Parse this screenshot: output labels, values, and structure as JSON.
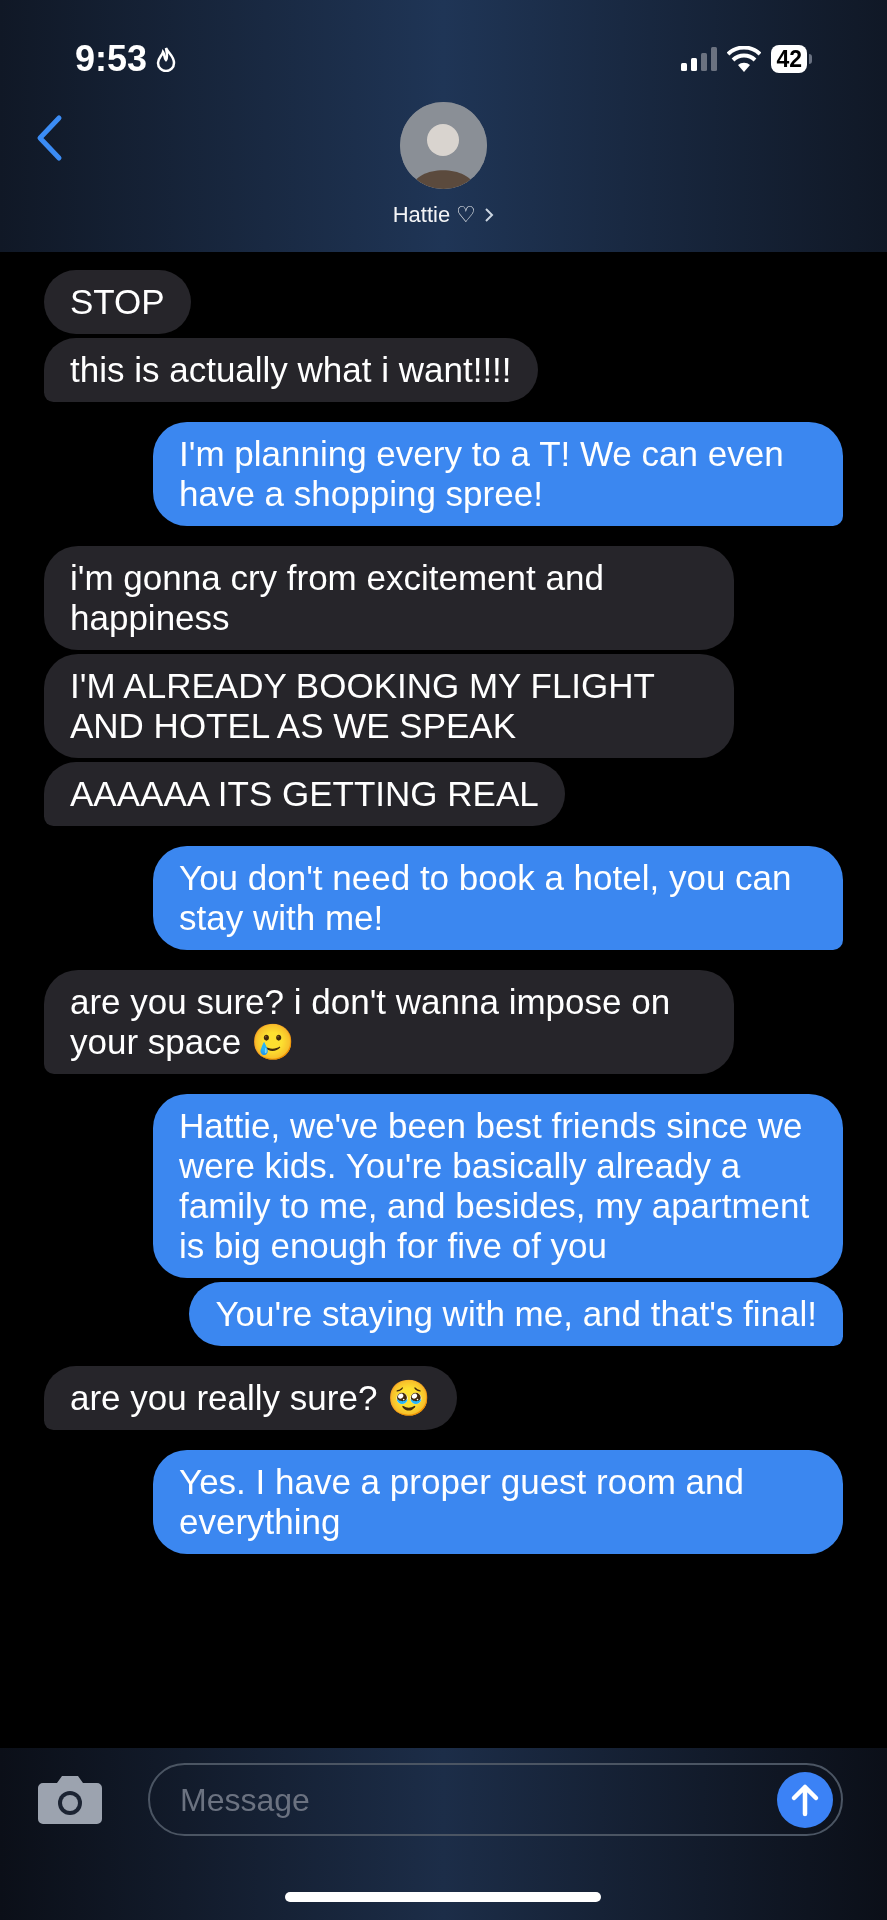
{
  "status_bar": {
    "time": "9:53",
    "battery": "42"
  },
  "contact": {
    "name": "Hattie ♡"
  },
  "messages": [
    {
      "kind": "received",
      "text": "STOP",
      "tail": false
    },
    {
      "kind": "received",
      "text": "this is actually what i want!!!!",
      "tail": true
    },
    {
      "kind": "sent",
      "text": "I'm planning every to a T! We can even have a shopping spree!",
      "tail": true
    },
    {
      "kind": "received",
      "text": "i'm gonna cry from excitement and happiness",
      "tail": false
    },
    {
      "kind": "received",
      "text": "I'M ALREADY BOOKING MY FLIGHT AND HOTEL AS WE SPEAK",
      "tail": false
    },
    {
      "kind": "received",
      "text": "AAAAAA ITS GETTING REAL",
      "tail": true
    },
    {
      "kind": "sent",
      "text": "You don't need to book a hotel, you can stay with me!",
      "tail": true
    },
    {
      "kind": "received",
      "text": "are you sure? i don't wanna impose on your space 🥲",
      "tail": true
    },
    {
      "kind": "sent",
      "text": "Hattie, we've been best friends since we were kids. You're basically already a family to me, and besides, my apartment is big enough for five of you",
      "tail": false
    },
    {
      "kind": "sent",
      "text": "You're staying with me, and that's final!",
      "tail": true
    },
    {
      "kind": "received",
      "text": "are you really sure? 🥹",
      "tail": true
    },
    {
      "kind": "sent",
      "text": "Yes. I have a proper guest room and everything",
      "tail": false
    }
  ],
  "composer": {
    "placeholder": "Message"
  }
}
